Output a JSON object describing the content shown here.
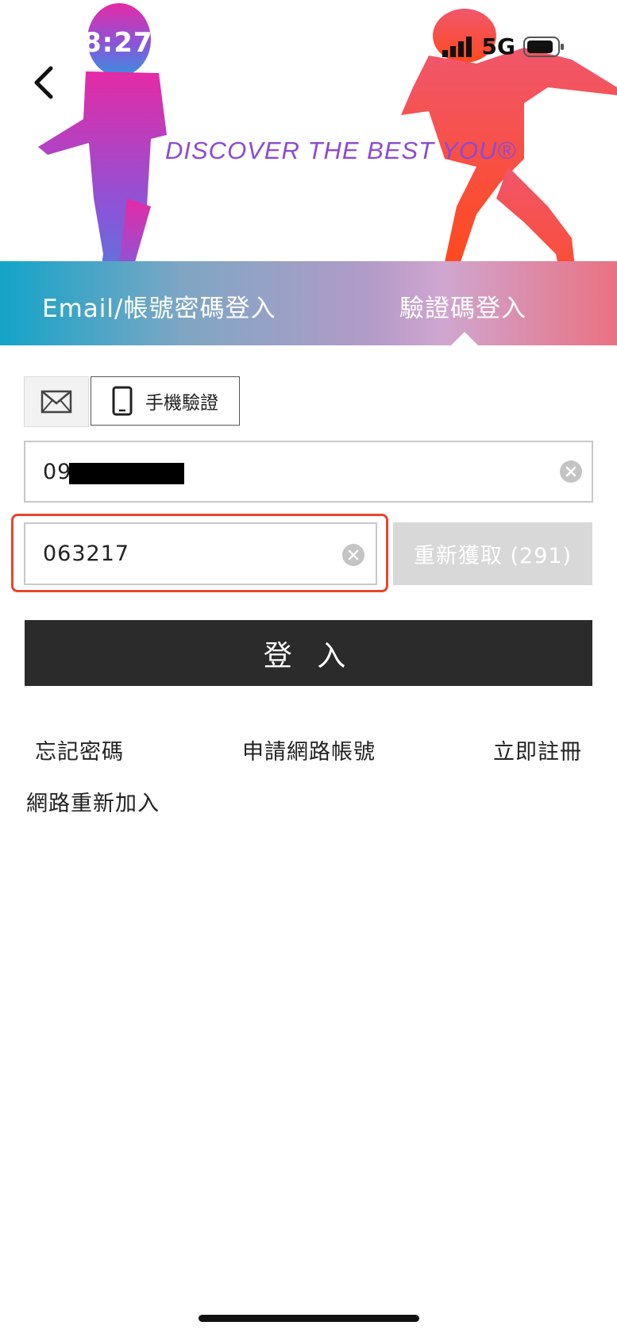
{
  "status_bar": {
    "time": "8:27",
    "network": "5G"
  },
  "hero": {
    "tagline": "DISCOVER THE BEST YOU®"
  },
  "tabs": [
    {
      "label": "Email/帳號密碼登入",
      "active": false
    },
    {
      "label": "驗證碼登入",
      "active": true
    }
  ],
  "method_toggle": {
    "phone_label": "手機驗證",
    "email_icon": "envelope-icon",
    "phone_icon": "phone-icon"
  },
  "phone_input": {
    "value_prefix": "09"
  },
  "code_input": {
    "value": "063217"
  },
  "resend_button": {
    "label": "重新獲取 (291)"
  },
  "login_button": {
    "label": "登 入"
  },
  "links": {
    "forgot_password": "忘記密碼",
    "apply_online": "申請網路帳號",
    "register_now": "立即註冊",
    "rejoin_online": "網路重新加入"
  },
  "colors": {
    "tab_gradient_start": "#13a4c8",
    "tab_gradient_end": "#ea7182",
    "tagline": "#8a4bd6",
    "login_button": "#2b2b2b",
    "resend_disabled": "#d8d8d8",
    "highlight_border": "#e8452a"
  }
}
